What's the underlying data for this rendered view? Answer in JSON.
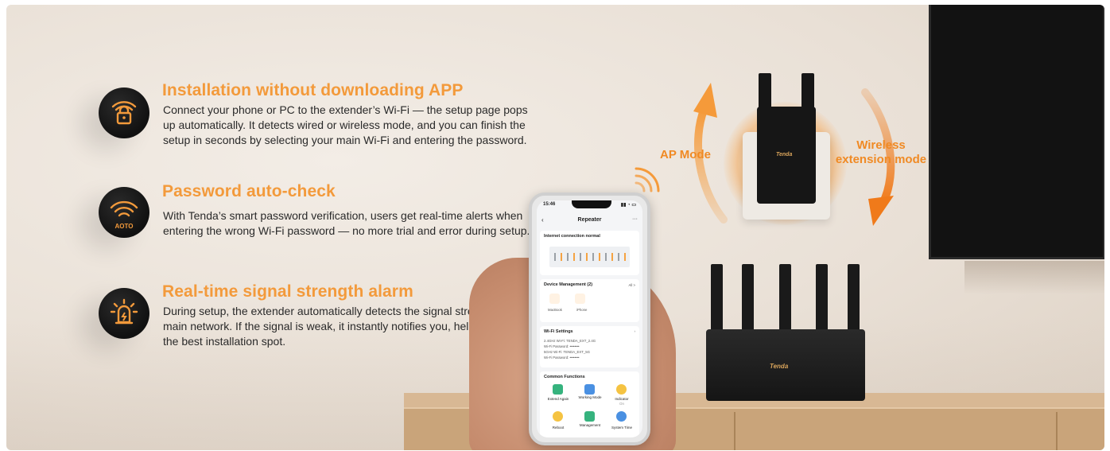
{
  "features": [
    {
      "title": "Installation without downloading APP",
      "body": "Connect your phone or PC to the extender’s Wi-Fi — the setup page pops up automatically. It detects wired or wireless mode, and you can finish the setup in seconds by selecting your main Wi-Fi and entering the password.",
      "icon": "wifi-lock-icon"
    },
    {
      "title": "Password auto-check",
      "body": "With Tenda’s smart password verification, users get real-time alerts when entering the wrong Wi-Fi password — no more trial and error during setup.",
      "icon": "wifi-check-icon",
      "icon_text": "AOTO"
    },
    {
      "title": "Real-time signal strength alarm",
      "body": "During setup, the extender automatically detects the signal strength of the main network. If the signal is weak, it instantly notifies you, helping you find the best installation spot.",
      "icon": "alarm-icon"
    }
  ],
  "modes": {
    "left": "AP Mode",
    "right_line1": "Wireless",
    "right_line2": "extension mode"
  },
  "brand": "Tenda",
  "phone": {
    "time": "15:46",
    "app_title": "Repeater",
    "status": "Internet connection normal",
    "device_mgmt": "Device Management (2)",
    "device_all": "All >",
    "devices": [
      "MacBook",
      "iPhone"
    ],
    "wifi_settings": "Wi-Fi Settings",
    "wifi_rows": [
      "2.4GHz Wi-Fi:  TENDA_EXT_2.4G",
      "Wi-Fi Password:  ••••••••",
      "5GHz Wi-Fi:  TENDA_EXT_5G",
      "Wi-Fi Password:  ••••••••"
    ],
    "common_functions": "Common Functions",
    "functions": [
      "Extend Again",
      "Working Mode",
      "Indicator",
      "Reboot",
      "Management",
      "System Time"
    ],
    "indicator_value": "On"
  },
  "colors": {
    "accent": "#f39a3b",
    "arrow": "#f08a24",
    "icon_bg": "#111111",
    "text": "#2a2a2a"
  }
}
